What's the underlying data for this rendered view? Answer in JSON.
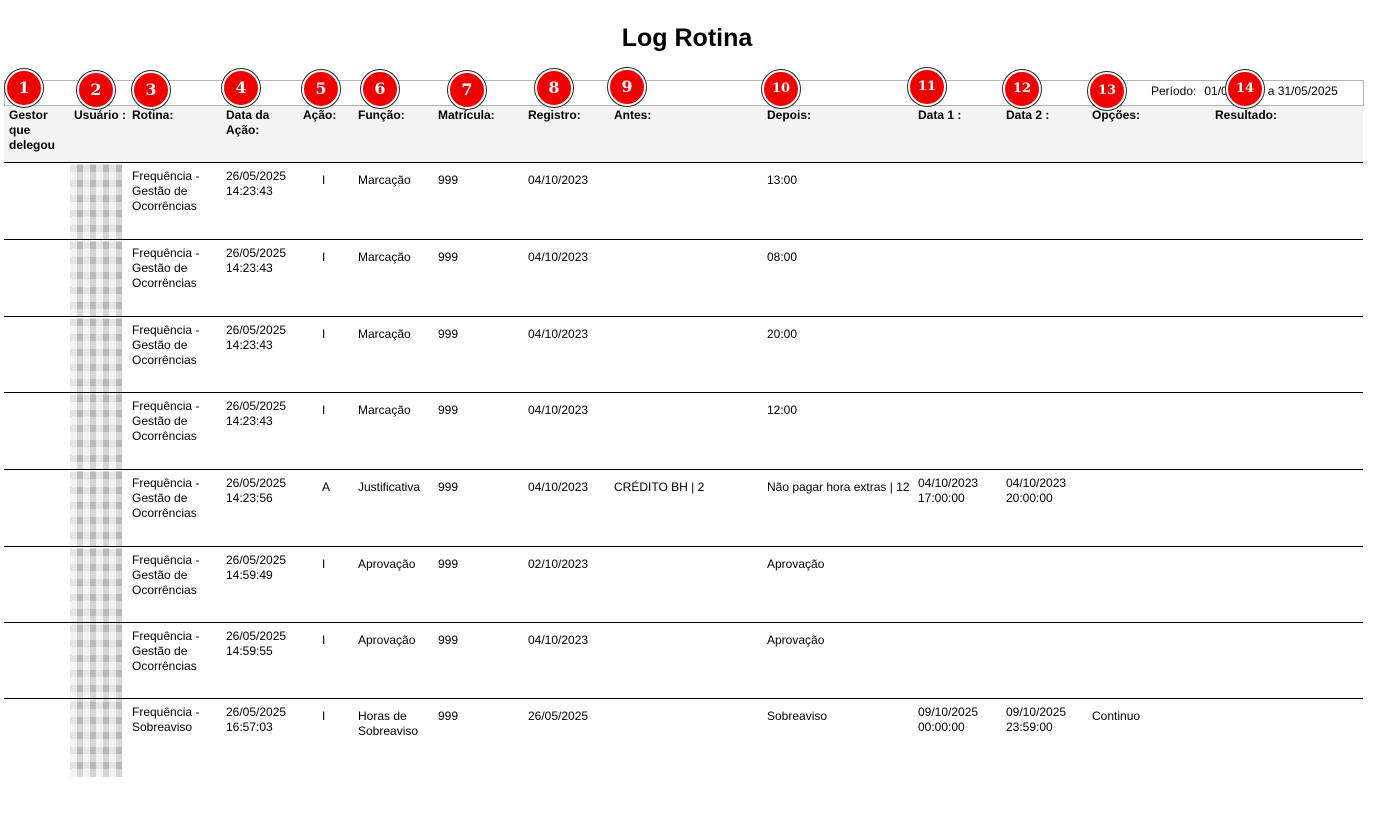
{
  "title": "Log Rotina",
  "periodo": {
    "label": "Período:",
    "value": "01/05/2025 a 31/05/2025"
  },
  "columns": [
    "Gestor que delegou",
    "Usuário :",
    "Rotina:",
    "Data da Ação:",
    "Ação:",
    "Função:",
    "Matrícula:",
    "Registro:",
    "Antes:",
    "Depois:",
    "Data 1 :",
    "Data 2 :",
    "Opções:",
    "Resultado:"
  ],
  "badges": [
    "1",
    "2",
    "3",
    "4",
    "5",
    "6",
    "7",
    "8",
    "9",
    "10",
    "11",
    "12",
    "13",
    "14"
  ],
  "rows": [
    {
      "gestor": "",
      "rotina": "Frequência - Gestão de Ocorrências",
      "data_acao": "26/05/2025 14:23:43",
      "acao": "I",
      "funcao": "Marcação",
      "matricula": "999",
      "registro": "04/10/2023",
      "antes": "",
      "depois": "13:00",
      "data1": "",
      "data2": "",
      "opcoes": "",
      "resultado": ""
    },
    {
      "gestor": "",
      "rotina": "Frequência - Gestão de Ocorrências",
      "data_acao": "26/05/2025 14:23:43",
      "acao": "I",
      "funcao": "Marcação",
      "matricula": "999",
      "registro": "04/10/2023",
      "antes": "",
      "depois": "08:00",
      "data1": "",
      "data2": "",
      "opcoes": "",
      "resultado": ""
    },
    {
      "gestor": "",
      "rotina": "Frequência - Gestão de Ocorrências",
      "data_acao": "26/05/2025 14:23:43",
      "acao": "I",
      "funcao": "Marcação",
      "matricula": "999",
      "registro": "04/10/2023",
      "antes": "",
      "depois": "20:00",
      "data1": "",
      "data2": "",
      "opcoes": "",
      "resultado": ""
    },
    {
      "gestor": "",
      "rotina": "Frequência - Gestão de Ocorrências",
      "data_acao": "26/05/2025 14:23:43",
      "acao": "I",
      "funcao": "Marcação",
      "matricula": "999",
      "registro": "04/10/2023",
      "antes": "",
      "depois": "12:00",
      "data1": "",
      "data2": "",
      "opcoes": "",
      "resultado": ""
    },
    {
      "gestor": "",
      "rotina": "Frequência - Gestão de Ocorrências",
      "data_acao": "26/05/2025 14:23:56",
      "acao": "A",
      "funcao": "Justificativa",
      "matricula": "999",
      "registro": "04/10/2023",
      "antes": "CRÉDITO BH | 2",
      "depois": "Não pagar hora extras | 12",
      "data1": "04/10/2023 17:00:00",
      "data2": "04/10/2023 20:00:00",
      "opcoes": "",
      "resultado": ""
    },
    {
      "gestor": "",
      "rotina": "Frequência - Gestão de Ocorrências",
      "data_acao": "26/05/2025 14:59:49",
      "acao": "I",
      "funcao": "Aprovação",
      "matricula": "999",
      "registro": "02/10/2023",
      "antes": "",
      "depois": "Aprovação",
      "data1": "",
      "data2": "",
      "opcoes": "",
      "resultado": ""
    },
    {
      "gestor": "",
      "rotina": "Frequência - Gestão de Ocorrências",
      "data_acao": "26/05/2025 14:59:55",
      "acao": "I",
      "funcao": "Aprovação",
      "matricula": "999",
      "registro": "04/10/2023",
      "antes": "",
      "depois": "Aprovação",
      "data1": "",
      "data2": "",
      "opcoes": "",
      "resultado": ""
    },
    {
      "gestor": "",
      "rotina": "Frequência - Sobreaviso",
      "data_acao": "26/05/2025 16:57:03",
      "acao": "I",
      "funcao": "Horas de Sobreaviso",
      "matricula": "999",
      "registro": "26/05/2025",
      "antes": "",
      "depois": "Sobreaviso",
      "data1": "09/10/2025 00:00:00",
      "data2": "09/10/2025 23:59:00",
      "opcoes": "Continuo",
      "resultado": ""
    }
  ]
}
